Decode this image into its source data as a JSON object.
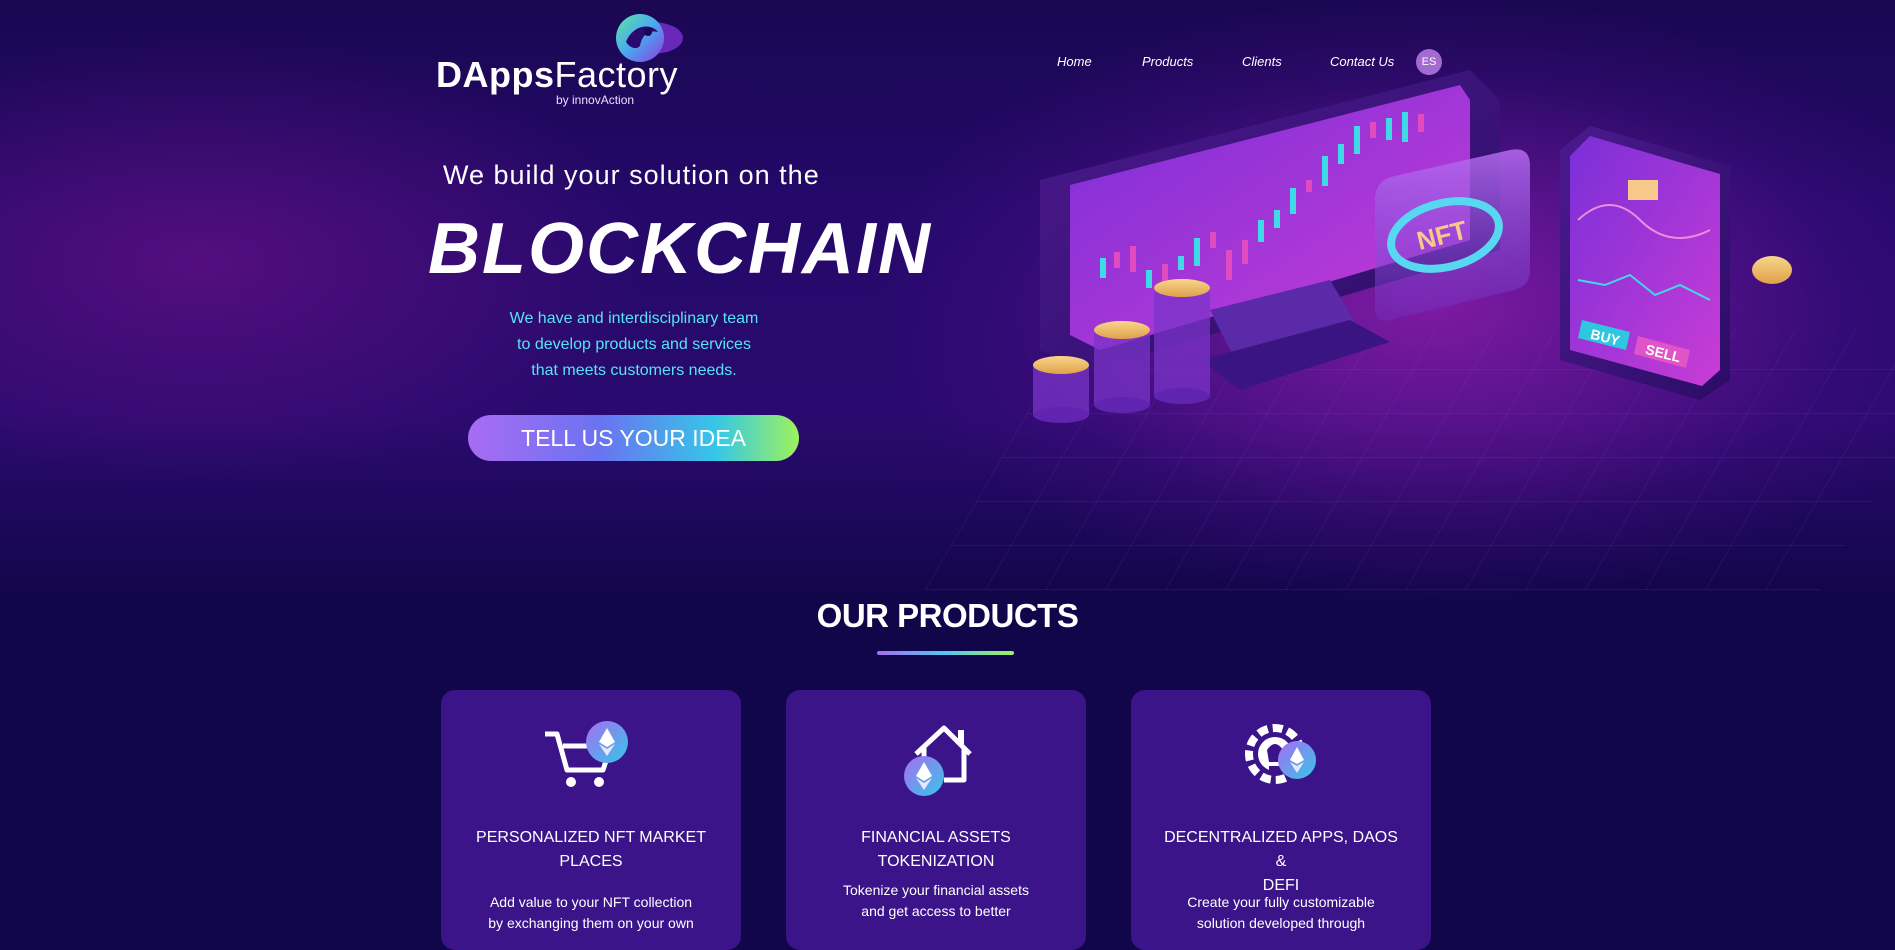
{
  "brand": {
    "name_bold": "DApps",
    "name_light": "Factory",
    "tagline": "by innovAction"
  },
  "nav": {
    "items": [
      {
        "label": "Home"
      },
      {
        "label": "Products"
      },
      {
        "label": "Clients"
      },
      {
        "label": "Contact Us"
      }
    ],
    "language": "ES"
  },
  "hero": {
    "pre_title": "We build your solution on the",
    "title": "BLOCKCHAIN",
    "description_lines": [
      "We have and interdisciplinary team",
      "to develop products and services",
      "that meets customers needs."
    ],
    "cta": "TELL US YOUR IDEA",
    "illustration": {
      "nft_label": "NFT",
      "buy_label": "BUY",
      "sell_label": "SELL"
    }
  },
  "products": {
    "title": "OUR PRODUCTS",
    "cards": [
      {
        "icon": "cart-ethereum-icon",
        "title_lines": [
          "PERSONALIZED NFT MARKET",
          "PLACES"
        ],
        "text_lines": [
          "Add value to your NFT collection",
          "by exchanging them on your own"
        ]
      },
      {
        "icon": "house-ethereum-icon",
        "title_lines": [
          "FINANCIAL ASSETS",
          "TOKENIZATION"
        ],
        "text_lines": [
          "Tokenize your financial assets",
          "and get access to better"
        ]
      },
      {
        "icon": "lightbulb-gear-ethereum-icon",
        "title_lines": [
          "DECENTRALIZED APPS, DAOS &",
          "DEFI"
        ],
        "text_lines": [
          "Create your fully customizable",
          "solution developed through"
        ]
      }
    ]
  },
  "colors": {
    "accent_cyan": "#56e3f6",
    "card_bg": "#3b1489",
    "page_bg": "#12064a"
  }
}
